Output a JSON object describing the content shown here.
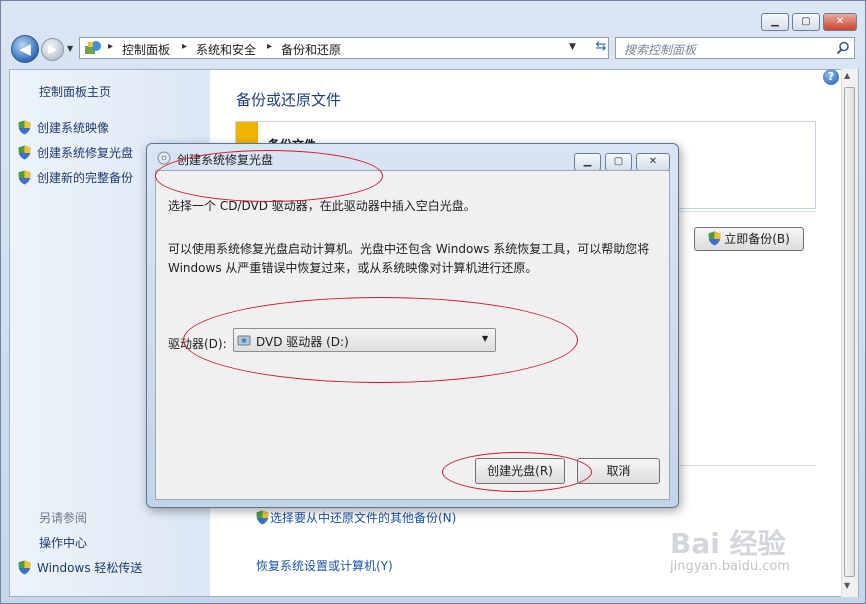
{
  "address": {
    "crumbs": [
      "控制面板",
      "系统和安全",
      "备份和还原"
    ],
    "search_placeholder": "搜索控制面板"
  },
  "sidebar": {
    "home": "控制面板主页",
    "items": [
      "创建系统映像",
      "创建系统修复光盘",
      "创建新的完整备份"
    ],
    "see_also_title": "另请参阅",
    "see_also": [
      "操作中心",
      "Windows 轻松传送"
    ]
  },
  "main": {
    "title": "备份或还原文件",
    "backup_section_label": "备份文件",
    "backup_now_button": "立即备份(B)",
    "links": [
      "选择要从中还原文件的其他备份(N)",
      "恢复系统设置或计算机(Y)"
    ]
  },
  "dialog": {
    "title": "创建系统修复光盘",
    "instruction": "选择一个 CD/DVD 驱动器，在此驱动器中插入空白光盘。",
    "description_line1": "可以使用系统修复光盘启动计算机。光盘中还包含 Windows 系统恢复工具，可以帮助您将",
    "description_line2": "Windows 从严重错误中恢复过来，或从系统映像对计算机进行还原。",
    "drive_label": "驱动器(D):",
    "drive_value": "DVD 驱动器 (D:)",
    "create_button": "创建光盘(R)",
    "cancel_button": "取消"
  },
  "watermark": {
    "brand": "Bai 经验",
    "url": "jingyan.baidu.com"
  },
  "icons": {
    "help": "help-icon",
    "shield": "uac-shield-icon",
    "dropdown": "chevron-down-icon"
  },
  "colors": {
    "link": "#1a55b0",
    "annotation": "#d8182a",
    "backup_accent": "#f0b400"
  }
}
